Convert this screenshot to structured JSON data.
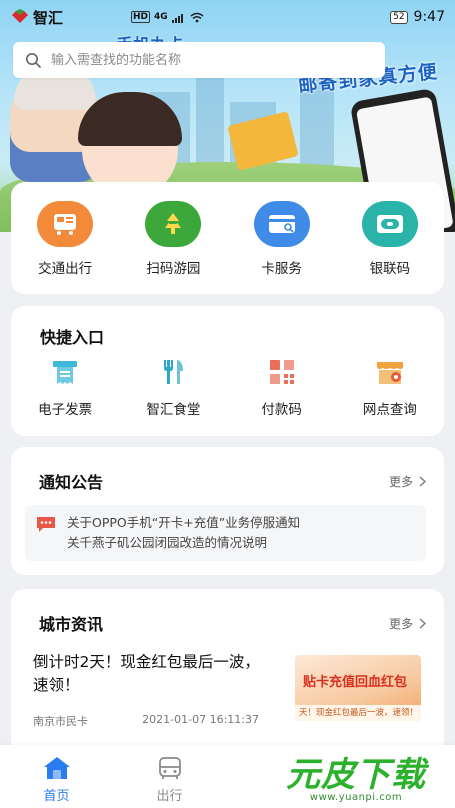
{
  "status_bar": {
    "app_name": "智汇",
    "network_badges": [
      "HD",
      "4G"
    ],
    "battery": "52",
    "time": "9:47"
  },
  "search": {
    "placeholder": "输入需查找的功能名称"
  },
  "banner": {
    "slogan_top": "手机办卡",
    "slogan": "邮寄到家真方便"
  },
  "main_services": [
    {
      "label": "交通出行",
      "icon": "transit-card-icon",
      "color": "#f28a3a"
    },
    {
      "label": "扫码游园",
      "icon": "park-scan-icon",
      "color": "#3ca83c"
    },
    {
      "label": "卡服务",
      "icon": "card-service-icon",
      "color": "#3f8be8"
    },
    {
      "label": "银联码",
      "icon": "unionpay-code-icon",
      "color": "#2ab3a9"
    }
  ],
  "quick_entry": {
    "title": "快捷入口",
    "items": [
      {
        "label": "电子发票",
        "icon": "invoice-icon",
        "color": "#3fb7d8"
      },
      {
        "label": "智汇食堂",
        "icon": "canteen-icon",
        "color": "#2fa8c8"
      },
      {
        "label": "付款码",
        "icon": "payment-code-icon",
        "color": "#e8705a"
      },
      {
        "label": "网点查询",
        "icon": "store-locator-icon",
        "color": "#f0a440"
      }
    ]
  },
  "notices": {
    "title": "通知公告",
    "more": "更多",
    "items": [
      "关于OPPO手机“开卡+充值”业务停服通知",
      "关千燕子矶公园闭园改造的情况说明"
    ]
  },
  "city_news": {
    "title": "城市资讯",
    "more": "更多",
    "headline": "倒计时2天！现金红包最后一波，速领！",
    "source": "南京市民卡",
    "date": "2021-01-07 16:11:37",
    "thumb_title": "贴卡充值回血红包",
    "thumb_strip": "天！现金红包最后一波，速领！"
  },
  "tabbar": {
    "items": [
      {
        "label": "首页",
        "icon": "home-icon",
        "active": true
      },
      {
        "label": "出行",
        "icon": "bus-icon",
        "active": false
      }
    ]
  },
  "watermark": {
    "main": "元皮下载",
    "sub": "www.yuanpi.com"
  }
}
